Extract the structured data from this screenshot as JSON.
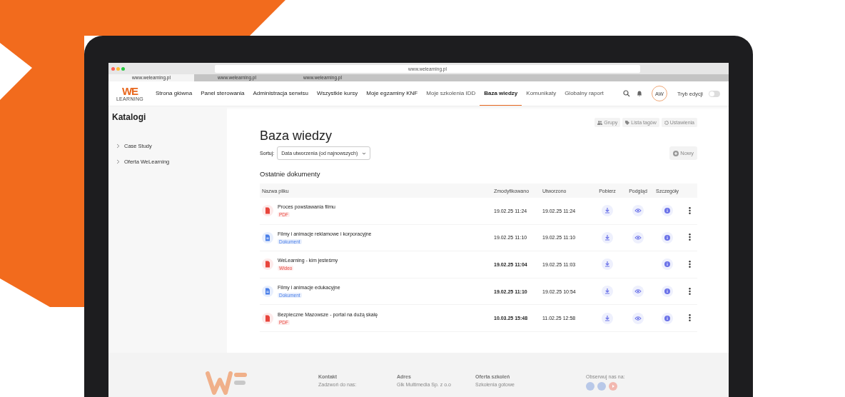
{
  "browser": {
    "tabs": [
      {
        "label": "www.welearning.pl",
        "selected": true
      },
      {
        "label": "www.welearning.pl",
        "selected": false
      },
      {
        "label": "www.welearning.pl",
        "selected": false
      }
    ],
    "address": "www.welearning.pl"
  },
  "nav": {
    "logo": "WE",
    "logo_sub": "LEARNING",
    "items": [
      {
        "label": "Strona główna",
        "selected": false,
        "muted": false
      },
      {
        "label": "Panel sterowania",
        "selected": false,
        "muted": false
      },
      {
        "label": "Administracja serwisu",
        "selected": false,
        "muted": false
      },
      {
        "label": "Wszystkie kursy",
        "selected": false,
        "muted": false
      },
      {
        "label": "Moje egzaminy KNF",
        "selected": false,
        "muted": false
      },
      {
        "label": "Moje szkolenia IDD",
        "selected": false,
        "muted": true
      },
      {
        "label": "Baza wiedzy",
        "selected": true,
        "muted": false
      },
      {
        "label": "Komunikaty",
        "selected": false,
        "muted": true
      },
      {
        "label": "Globalny raport",
        "selected": false,
        "muted": true
      }
    ],
    "avatar": "AW",
    "edit_mode": {
      "label": "Tryb edycji",
      "on": false
    }
  },
  "sidebar": {
    "title": "Katalogi",
    "items": [
      {
        "label": "Case Study",
        "expanded": false
      },
      {
        "label": "Oferta WeLearning",
        "expanded": false
      }
    ]
  },
  "toolbar": [
    "Grupy",
    "Lista tagów",
    "Ustawienia"
  ],
  "title": "Baza wiedzy",
  "sort": {
    "label": "Sortuj:",
    "value": "Data utworzenia (od najnowszych)"
  },
  "new_button": "Nowy",
  "section": "Ostatnie dokumenty",
  "table": {
    "columns": [
      "Nazwa pliku",
      "Zmodyfikowano",
      "Utworzono",
      "Pobierz",
      "Podgląd",
      "Szczegóły"
    ],
    "rows": [
      {
        "name": "Proces powstawania filmu",
        "type": "PDF",
        "kind": "pdf",
        "modified": "19.02.25 11:24",
        "created": "19.02.25 11:24",
        "preview": true,
        "bold": false
      },
      {
        "name": "Filmy i animacje reklamowe i korporacyjne",
        "type": "Dokument",
        "kind": "doc",
        "modified": "19.02.25 11:10",
        "created": "19.02.25 11:10",
        "preview": true,
        "bold": false
      },
      {
        "name": "WeLearning - kim jesteśmy",
        "type": "Wideo",
        "kind": "pdf",
        "modified": "19.02.25 11:04",
        "created": "19.02.25 11:03",
        "preview": false,
        "bold": true
      },
      {
        "name": "Filmy i animacje edukacyjne",
        "type": "Dokument",
        "kind": "doc",
        "modified": "19.02.25 11:10",
        "created": "19.02.25 10:54",
        "preview": true,
        "bold": true
      },
      {
        "name": "Bezpieczne Mazowsze - portal na dużą skalę",
        "type": "PDF",
        "kind": "pdf",
        "modified": "10.03.25 15:48",
        "created": "11.02.25 12:58",
        "preview": true,
        "bold": true
      }
    ]
  },
  "footer": {
    "columns": [
      {
        "heading": "Kontakt",
        "line": "Zadzwoń do nas:"
      },
      {
        "heading": "Adres",
        "line": "Glk Multimedia Sp. z o.o"
      },
      {
        "heading": "Oferta szkoleń",
        "line": "Szkolenia gotowe"
      }
    ],
    "follow": "Obserwuj nas na:"
  }
}
